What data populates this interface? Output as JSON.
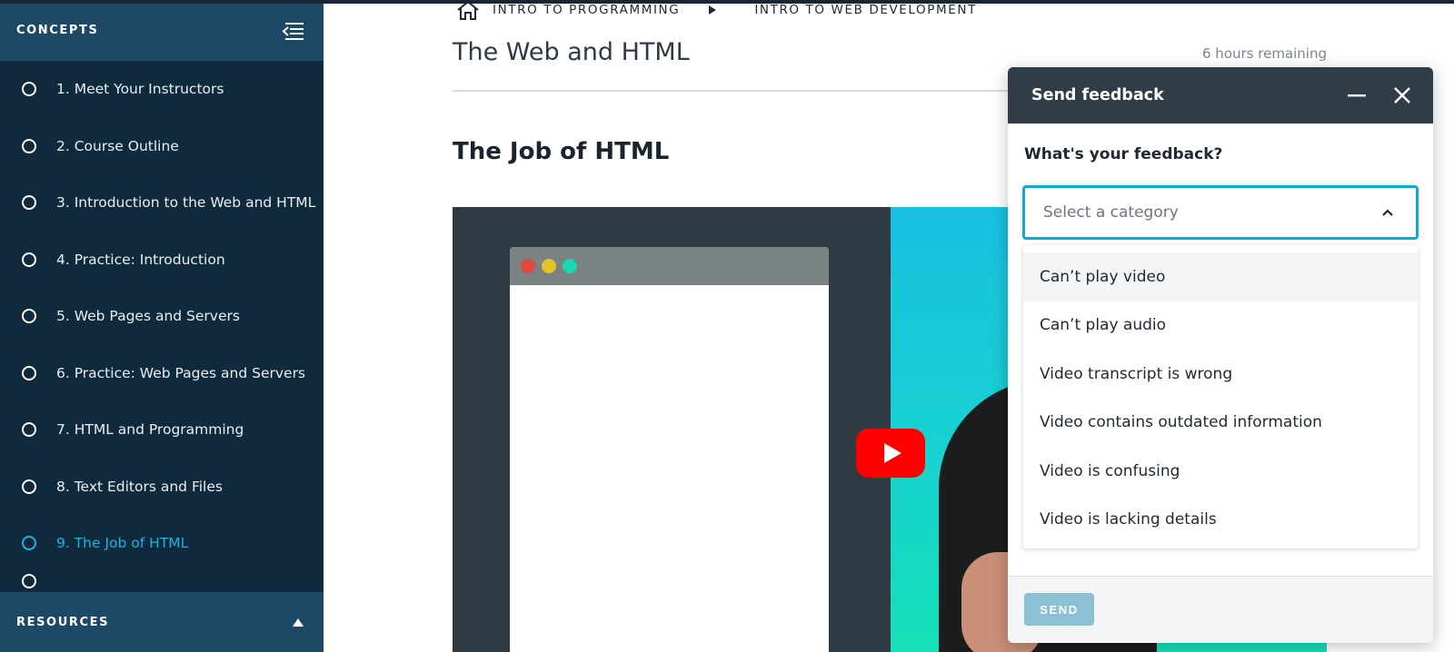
{
  "sidebar": {
    "header_title": "CONCEPTS",
    "items": [
      {
        "label": "1. Meet Your Instructors"
      },
      {
        "label": "2. Course Outline"
      },
      {
        "label": "3. Introduction to the Web and HTML"
      },
      {
        "label": "4. Practice: Introduction"
      },
      {
        "label": "5. Web Pages and Servers"
      },
      {
        "label": "6. Practice: Web Pages and Servers"
      },
      {
        "label": "7. HTML and Programming"
      },
      {
        "label": "8. Text Editors and Files"
      },
      {
        "label": "9. The Job of HTML"
      }
    ],
    "active_index": 8,
    "footer_title": "RESOURCES"
  },
  "breadcrumb": {
    "items": [
      "INTRO TO PROGRAMMING",
      "INTRO TO WEB DEVELOPMENT"
    ]
  },
  "main": {
    "page_title": "The Web and HTML",
    "remaining": "6 hours remaining",
    "section_title": "The Job of HTML"
  },
  "feedback": {
    "title": "Send feedback",
    "question": "What's your feedback?",
    "select_placeholder": "Select a category",
    "options": [
      "Can’t play video",
      "Can’t play audio",
      "Video transcript is wrong",
      "Video contains outdated information",
      "Video is confusing",
      "Video is lacking details"
    ],
    "send_label": "SEND"
  },
  "colors": {
    "sidebar_bg": "#102a3d",
    "sidebar_header_bg": "#1d4866",
    "active_item": "#19b5de",
    "panel_header_bg": "#2f3d48",
    "select_border": "#10a9d6",
    "send_button": "#8cc0d5",
    "play_button": "#ff0000"
  }
}
